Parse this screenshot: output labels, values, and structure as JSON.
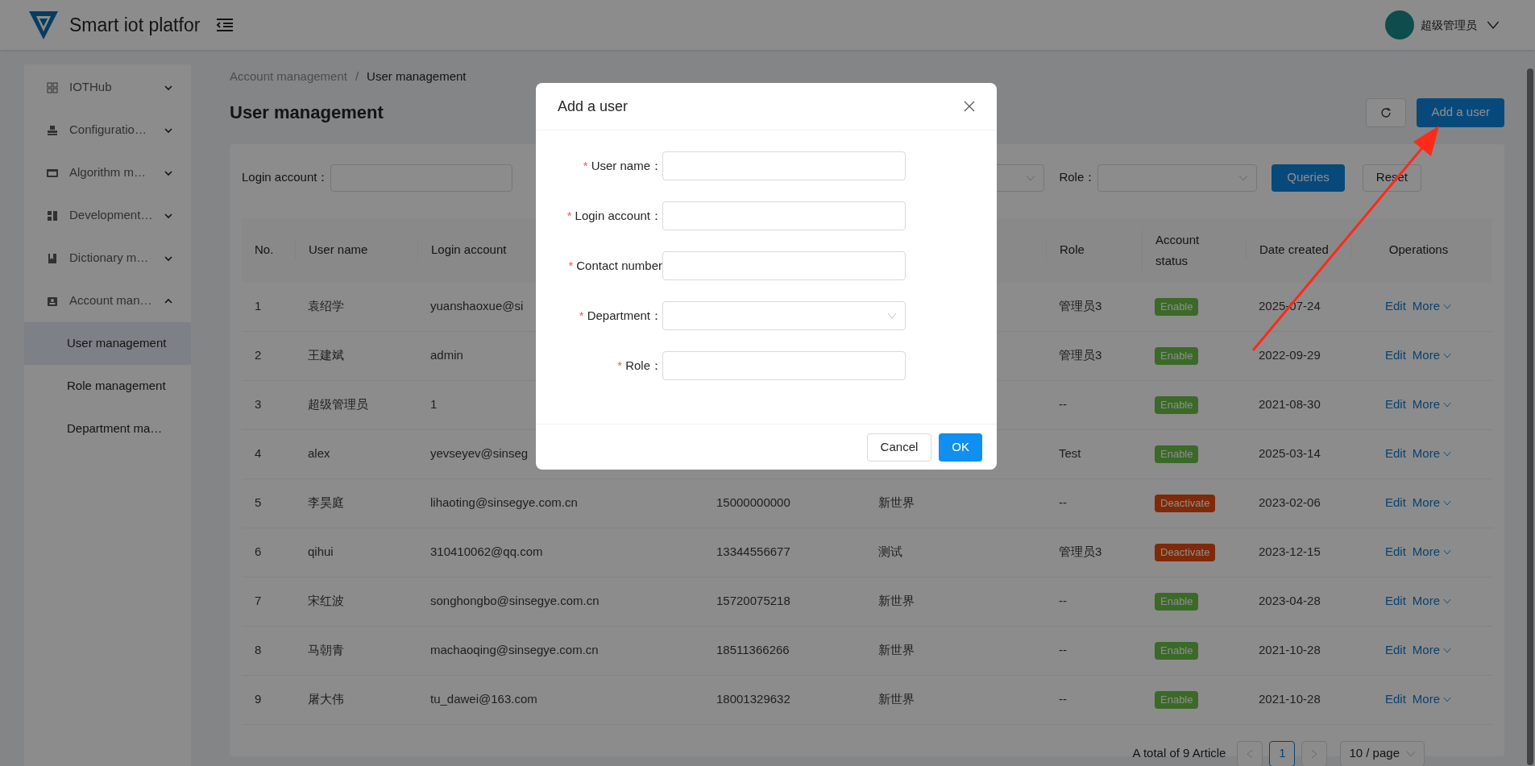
{
  "header": {
    "brand": "Smart iot platfor",
    "user_name": "超级管理员"
  },
  "sidebar": {
    "items": [
      {
        "label": "IOTHub",
        "expanded": false
      },
      {
        "label": "Configuratio…",
        "expanded": false
      },
      {
        "label": "Algorithm m…",
        "expanded": false
      },
      {
        "label": "Development…",
        "expanded": false
      },
      {
        "label": "Dictionary m…",
        "expanded": false
      },
      {
        "label": "Account man…",
        "expanded": true,
        "children": [
          {
            "label": "User management",
            "selected": true
          },
          {
            "label": "Role management",
            "selected": false
          },
          {
            "label": "Department ma…",
            "selected": false
          }
        ]
      }
    ]
  },
  "breadcrumb": [
    "Account management",
    "User management"
  ],
  "breadcrumb_separator": "/",
  "page_title": "User management",
  "add_button": "Add a user",
  "filters": {
    "login_label": "Login account：",
    "role_label": "Role：",
    "query_button": "Queries",
    "reset_button": "Reset"
  },
  "table": {
    "columns": [
      "No.",
      "User name",
      "Login account",
      "Role",
      "Account status",
      "Date created",
      "Operations"
    ],
    "rows": [
      {
        "no": "1",
        "user_name": "袁绍学",
        "login_account": "yuanshaoxue@si",
        "role": "管理员3",
        "enabled": true,
        "status": "Enable",
        "date_created": "2025-07-24",
        "actions": [
          "Edit",
          "More"
        ]
      },
      {
        "no": "2",
        "user_name": "王建斌",
        "login_account": "admin",
        "role": "管理员3",
        "enabled": true,
        "status": "Enable",
        "date_created": "2022-09-29",
        "actions": [
          "Edit",
          "More"
        ]
      },
      {
        "no": "3",
        "user_name": "超级管理员",
        "login_account": "1",
        "role": "--",
        "enabled": true,
        "status": "Enable",
        "date_created": "2021-08-30",
        "actions": [
          "Edit",
          "More"
        ]
      },
      {
        "no": "4",
        "user_name": "alex",
        "login_account": "yevseyev@sinseg",
        "role": "Test",
        "enabled": true,
        "status": "Enable",
        "date_created": "2025-03-14",
        "actions": [
          "Edit",
          "More"
        ]
      },
      {
        "no": "5",
        "user_name": "李昊庭",
        "login_account": "lihaoting@sinsegye.com.cn",
        "contact_number": "15000000000",
        "department": "新世界",
        "role": "--",
        "enabled": false,
        "status": "Deactivate",
        "date_created": "2023-02-06",
        "actions": [
          "Edit",
          "More"
        ]
      },
      {
        "no": "6",
        "user_name": "qihui",
        "login_account": "310410062@qq.com",
        "contact_number": "13344556677",
        "department": "测试",
        "role": "管理员3",
        "enabled": false,
        "status": "Deactivate",
        "date_created": "2023-12-15",
        "actions": [
          "Edit",
          "More"
        ]
      },
      {
        "no": "7",
        "user_name": "宋红波",
        "login_account": "songhongbo@sinsegye.com.cn",
        "contact_number": "15720075218",
        "department": "新世界",
        "role": "--",
        "enabled": true,
        "status": "Enable",
        "date_created": "2023-04-28",
        "actions": [
          "Edit",
          "More"
        ]
      },
      {
        "no": "8",
        "user_name": "马朝青",
        "login_account": "machaoqing@sinsegye.com.cn",
        "contact_number": "18511366266",
        "department": "新世界",
        "role": "--",
        "enabled": true,
        "status": "Enable",
        "date_created": "2021-10-28",
        "actions": [
          "Edit",
          "More"
        ]
      },
      {
        "no": "9",
        "user_name": "屠大伟",
        "login_account": "tu_dawei@163.com",
        "contact_number": "18001329632",
        "department": "新世界",
        "role": "--",
        "enabled": true,
        "status": "Enable",
        "date_created": "2021-10-28",
        "actions": [
          "Edit",
          "More"
        ]
      }
    ]
  },
  "pagination": {
    "total": "A total of 9 Article",
    "pages": [
      {
        "label": "1",
        "selected": true
      }
    ],
    "page_size": "10 / page"
  },
  "dialog": {
    "title": "Add a user",
    "fields": [
      {
        "label": "User name：",
        "required": true,
        "kind": "text"
      },
      {
        "label": "Login account：",
        "required": true,
        "kind": "text"
      },
      {
        "label": "Contact number",
        "required": true,
        "kind": "text"
      },
      {
        "label": "Department：",
        "required": true,
        "kind": "select"
      },
      {
        "label": "Role：",
        "required": true,
        "kind": "text"
      }
    ],
    "required_mark": "*",
    "cancel_button": "Cancel",
    "ok_button": "OK"
  }
}
